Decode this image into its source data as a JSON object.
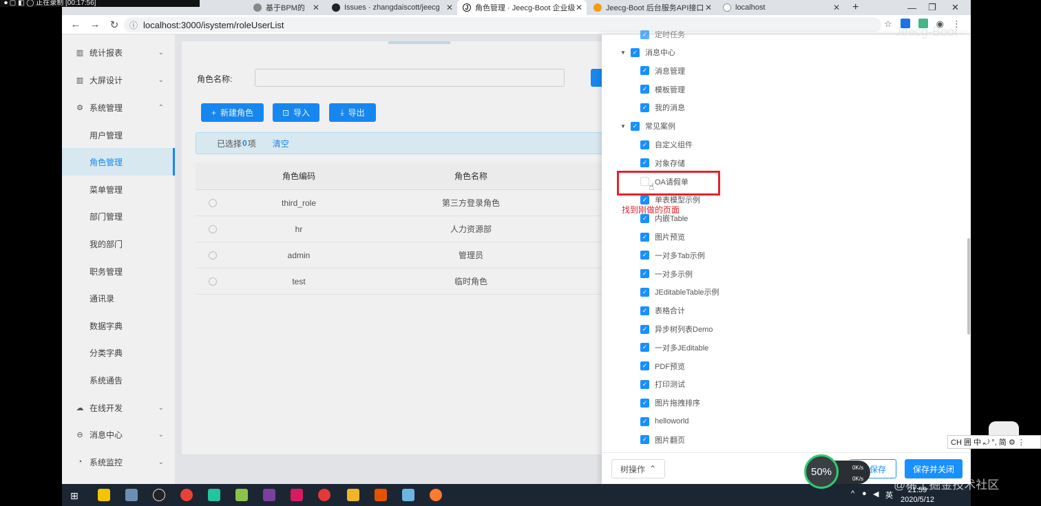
{
  "recorder": {
    "status": "正在录制 [00:17:56]"
  },
  "browser": {
    "tabs": [
      {
        "label": "基于BPM的",
        "favicon": "#888888"
      },
      {
        "label": "Issues · zhangdaiscott/jeecg",
        "favicon": "#222222"
      },
      {
        "label": "角色管理 · Jeecg-Boot 企业级",
        "favicon": "#1a1a1a"
      },
      {
        "label": "Jeecg-Boot 后台服务API接口",
        "favicon": "#f39c12"
      },
      {
        "label": "localhost",
        "favicon": "#bbbbbb"
      }
    ],
    "new_tab": "+",
    "url": "localhost:3000/isystem/roleUserList",
    "watermark": "Jeecg-Boot"
  },
  "sidebar": {
    "groups": [
      {
        "label": "统计报表",
        "icon": "bar-chart-icon"
      },
      {
        "label": "大屏设计",
        "icon": "bar-chart-icon"
      },
      {
        "label": "系统管理",
        "icon": "setting-icon",
        "expanded": true
      }
    ],
    "sub_items": [
      "用户管理",
      "角色管理",
      "菜单管理",
      "部门管理",
      "我的部门",
      "职务管理",
      "通讯录",
      "数据字典",
      "分类字典",
      "系统通告"
    ],
    "active_item": "角色管理",
    "bottom_groups": [
      {
        "label": "在线开发",
        "icon": "cloud-icon"
      },
      {
        "label": "消息中心",
        "icon": "message-icon"
      },
      {
        "label": "系统监控",
        "icon": "dashboard-icon"
      }
    ]
  },
  "query": {
    "role_name_label": "角色名称:",
    "role_name_value": ""
  },
  "toolbar": {
    "new_role": "新建角色",
    "import": "导入",
    "export": "导出"
  },
  "selection": {
    "prefix": "已选择",
    "count": "0",
    "suffix": "项",
    "clear": "清空"
  },
  "table": {
    "columns": [
      "角色编码",
      "角色名称"
    ],
    "rows": [
      {
        "code": "third_role",
        "name": "第三方登录角色"
      },
      {
        "code": "hr",
        "name": "人力资源部"
      },
      {
        "code": "admin",
        "name": "管理员"
      },
      {
        "code": "test",
        "name": "临时角色"
      }
    ]
  },
  "tree": {
    "top_partial": "定时任务",
    "nodes": [
      {
        "label": "消息中心",
        "level": 0,
        "checked": true,
        "expanded": true
      },
      {
        "label": "消息管理",
        "level": 1,
        "checked": true
      },
      {
        "label": "模板管理",
        "level": 1,
        "checked": true
      },
      {
        "label": "我的消息",
        "level": 1,
        "checked": true
      },
      {
        "label": "常见案例",
        "level": 0,
        "checked": true,
        "expanded": true
      },
      {
        "label": "自定义组件",
        "level": 1,
        "checked": true
      },
      {
        "label": "对象存储",
        "level": 1,
        "checked": true
      },
      {
        "label": "OA请假单",
        "level": 1,
        "checked": false
      },
      {
        "label": "单表模型示例",
        "level": 1,
        "checked": true
      },
      {
        "label": "内嵌Table",
        "level": 1,
        "checked": true
      },
      {
        "label": "图片预览",
        "level": 1,
        "checked": true
      },
      {
        "label": "一对多Tab示例",
        "level": 1,
        "checked": true
      },
      {
        "label": "一对多示例",
        "level": 1,
        "checked": true
      },
      {
        "label": "JEditableTable示例",
        "level": 1,
        "checked": true
      },
      {
        "label": "表格合计",
        "level": 1,
        "checked": true
      },
      {
        "label": "异步树列表Demo",
        "level": 1,
        "checked": true
      },
      {
        "label": "一对多JEditable",
        "level": 1,
        "checked": true
      },
      {
        "label": "PDF预览",
        "level": 1,
        "checked": true
      },
      {
        "label": "打印测试",
        "level": 1,
        "checked": true
      },
      {
        "label": "图片拖拽排序",
        "level": 1,
        "checked": true
      },
      {
        "label": "helloworld",
        "level": 1,
        "checked": true
      },
      {
        "label": "图片翻页",
        "level": 1,
        "checked": true
      }
    ],
    "annotation": "找到刚做的页面"
  },
  "drawer_footer": {
    "tree_ops": "树操作",
    "save": "仅保存",
    "save_and_close": "保存并关闭"
  },
  "speed_widget": {
    "percent": "50%",
    "up": "0K/s",
    "down": "0K/s"
  },
  "taskbar": {
    "time": "21:59",
    "date": "2020/5/12",
    "ime_lang": "英"
  },
  "ime_bar": "CH 囲 中 ⤾ °, 简 ⚙ ⋮",
  "site_watermark": "@稀土掘金技术社区",
  "colors": {
    "primary": "#1890ff",
    "highlight": "#e6212b",
    "sidebar_active_bg": "#e6f7ff"
  }
}
